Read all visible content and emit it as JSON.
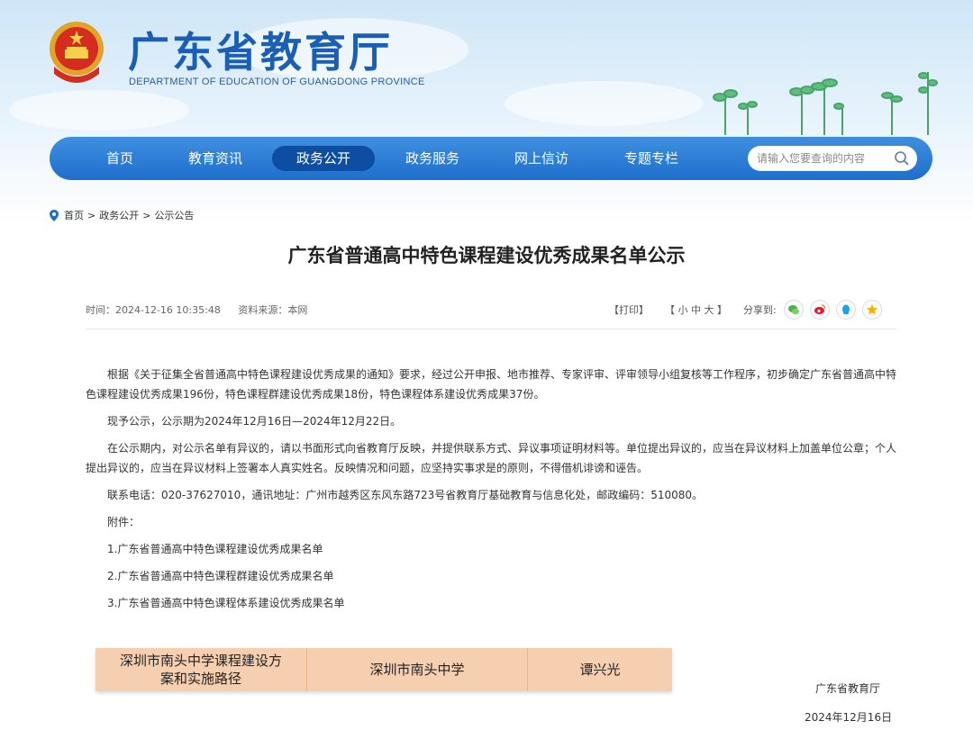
{
  "header": {
    "site_title": "广东省教育厅",
    "site_subtitle": "DEPARTMENT OF EDUCATION OF GUANGDONG PROVINCE"
  },
  "nav": {
    "items": [
      {
        "label": "首页",
        "active": false
      },
      {
        "label": "教育资讯",
        "active": false
      },
      {
        "label": "政务公开",
        "active": true
      },
      {
        "label": "政务服务",
        "active": false
      },
      {
        "label": "网上信访",
        "active": false
      },
      {
        "label": "专题专栏",
        "active": false
      }
    ],
    "search_placeholder": "请输入您要查询的内容"
  },
  "breadcrumb": {
    "items": [
      "首页",
      "政务公开",
      "公示公告"
    ],
    "separator": ">"
  },
  "article": {
    "title": "广东省普通高中特色课程建设优秀成果名单公示",
    "time": "时间：2024-12-16 10:35:48",
    "source": "资料来源：本网",
    "print_label": "【打印】",
    "font_size_label": "【 小  中  大 】",
    "share_label": "分享到:",
    "paragraphs": [
      "根据《关于征集全省普通高中特色课程建设优秀成果的通知》要求，经过公开申报、地市推荐、专家评审、评审领导小组复核等工作程序，初步确定广东省普通高中特色课程建设优秀成果196份，特色课程群建设优秀成果18份，特色课程体系建设优秀成果37份。",
      "现予公示，公示期为2024年12月16日—2024年12月22日。",
      "在公示期内，对公示名单有异议的，请以书面形式向省教育厅反映，并提供联系方式、异议事项证明材料等。单位提出异议的，应当在异议材料上加盖单位公章；个人提出异议的，应当在异议材料上签署本人真实姓名。反映情况和问题，应坚持实事求是的原则，不得借机诽谤和诬告。",
      "联系电话：020-37627010，通讯地址：广州市越秀区东风东路723号省教育厅基础教育与信息化处，邮政编码：510080。",
      "附件：",
      "1.广东省普通高中特色课程建设优秀成果名单",
      "2.广东省普通高中特色课程群建设优秀成果名单",
      "3.广东省普通高中特色课程体系建设优秀成果名单"
    ],
    "image_row": [
      "深圳市南头中学课程建设方案和实施路径",
      "深圳市南头中学",
      "谭兴光"
    ],
    "sign_org": "广东省教育厅",
    "sign_date": "2024年12月16日"
  },
  "colors": {
    "brand_blue": "#1a5fb4",
    "nav_active": "#0d4ea3",
    "strip_bg": "#f6cfb0"
  },
  "icons": [
    "emblem-icon",
    "location-pin-icon",
    "search-icon",
    "wechat-icon",
    "weibo-icon",
    "qq-icon",
    "qzone-icon"
  ]
}
